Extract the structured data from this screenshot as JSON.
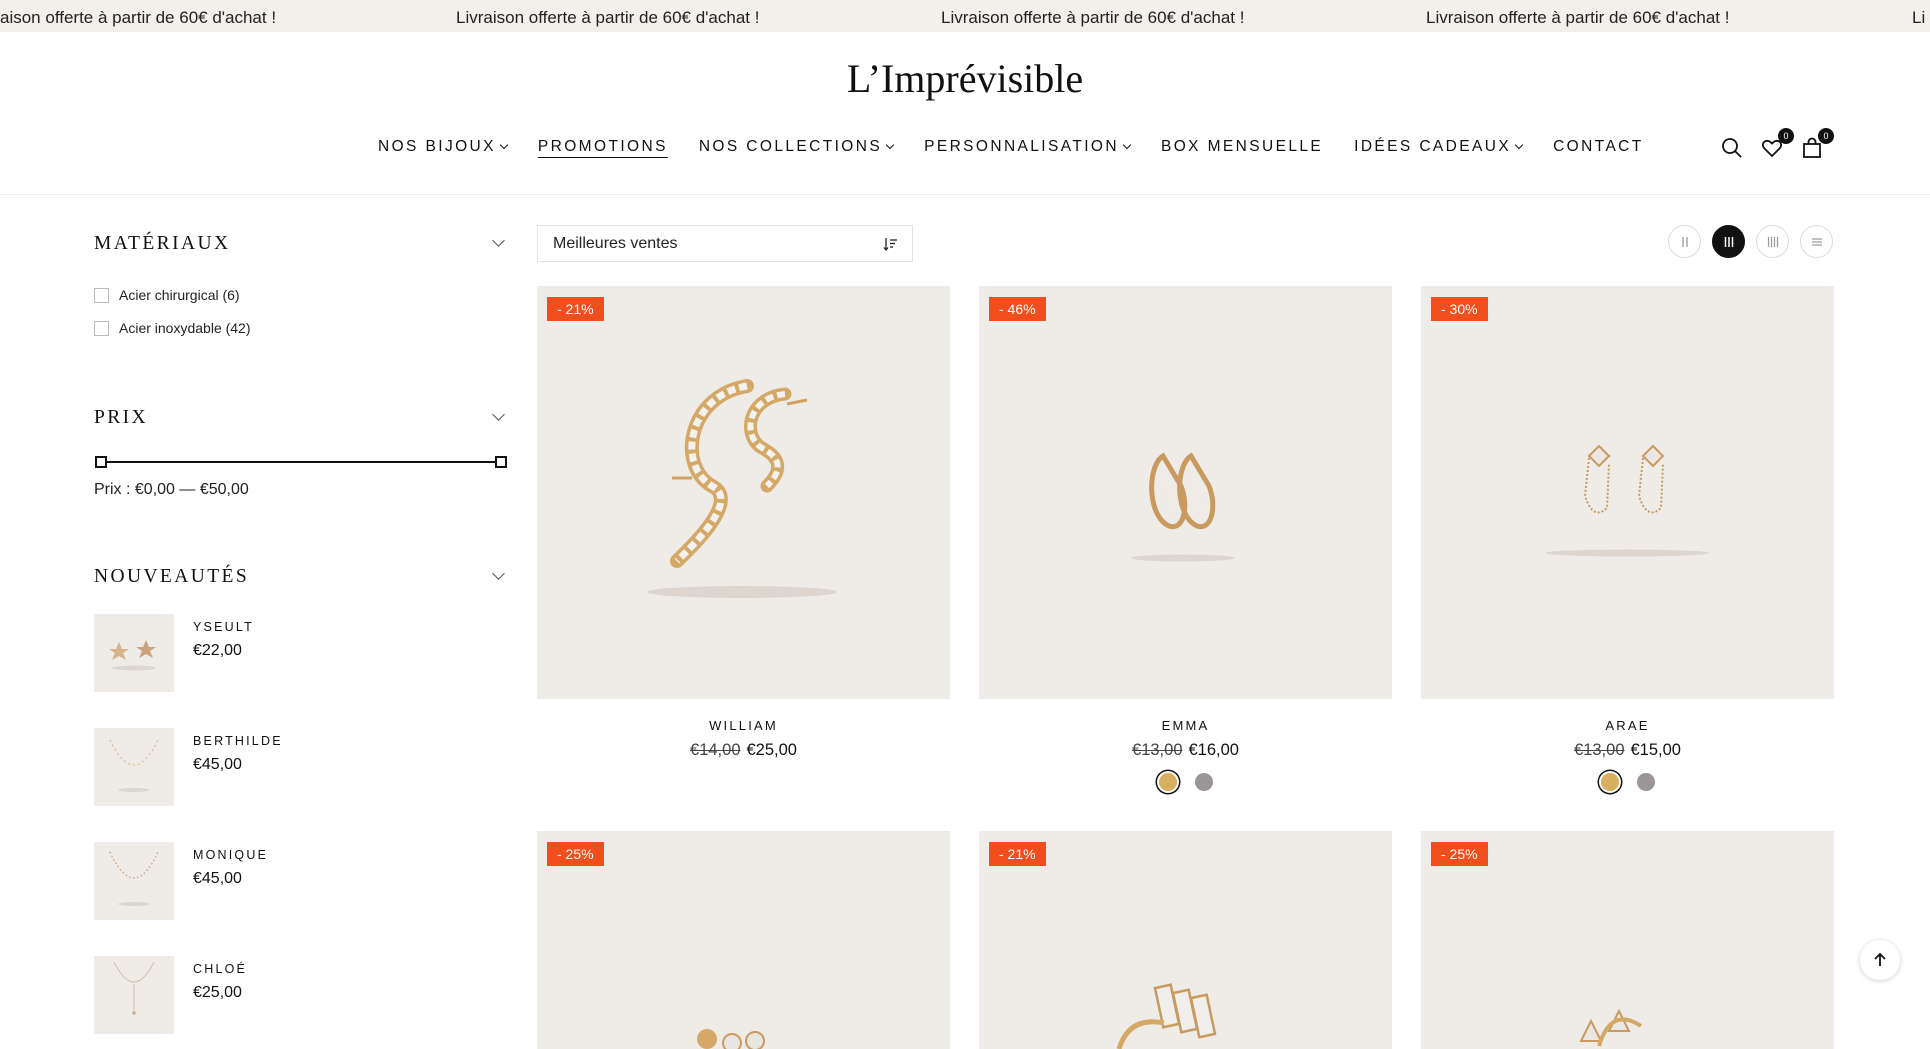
{
  "announcement": {
    "text1": "aison offerte à partir de 60€ d'achat !",
    "text2": "Livraison offerte à partir de 60€ d'achat !",
    "text3": "Livraison offerte à partir de 60€ d'achat !",
    "text4": "Livraison offerte à partir de 60€ d'achat !",
    "text5": "Li"
  },
  "header": {
    "logo": "L’Imprévisible",
    "nav": [
      {
        "label": "NOS BIJOUX"
      },
      {
        "label": "PROMOTIONS"
      },
      {
        "label": "NOS COLLECTIONS"
      },
      {
        "label": "PERSONNALISATION"
      },
      {
        "label": "BOX MENSUELLE"
      },
      {
        "label": "IDÉES CADEAUX"
      },
      {
        "label": "CONTACT"
      }
    ],
    "wishlist_count": "0",
    "cart_count": "0",
    "icons": [
      "search-icon",
      "heart-icon",
      "bag-icon"
    ]
  },
  "sidebar": {
    "materials_title": "MATÉRIAUX",
    "materials": [
      {
        "label": "Acier chirurgical (6)"
      },
      {
        "label": "Acier inoxydable (42)"
      }
    ],
    "price_title": "PRIX",
    "price_label": "Prix :  €0,00 — €50,00",
    "price_range": {
      "min_value": 0,
      "max_value": 50
    },
    "new_title": "NOUVEAUTÉS",
    "new_items": [
      {
        "name": "YSEULT",
        "price": "€22,00"
      },
      {
        "name": "BERTHILDE",
        "price": "€45,00"
      },
      {
        "name": "MONIQUE",
        "price": "€45,00"
      },
      {
        "name": "CHLOÉ",
        "price": "€25,00"
      }
    ]
  },
  "toolbar": {
    "sort_value": "Meilleures ventes",
    "layout_options": [
      "two-columns-icon",
      "three-columns-icon",
      "four-columns-icon",
      "list-view-icon"
    ],
    "active_layout": "three-columns-icon"
  },
  "products": [
    {
      "badge": "- 21%",
      "name": "WILLIAM",
      "old_price": "€14,00",
      "price": "€25,00",
      "swatches": []
    },
    {
      "badge": "- 46%",
      "name": "EMMA",
      "old_price": "€13,00",
      "price": "€16,00",
      "swatches": [
        "#d8ae5f",
        "#9a9695"
      ]
    },
    {
      "badge": "- 30%",
      "name": "ARAE",
      "old_price": "€13,00",
      "price": "€15,00",
      "swatches": [
        "#d8ae5f",
        "#9a9695"
      ]
    },
    {
      "badge": "- 25%"
    },
    {
      "badge": "- 21%"
    },
    {
      "badge": "- 25%"
    }
  ],
  "colors": {
    "badge": "#f04e1c",
    "image_background": "#efebe7",
    "announcement_background": "#f3efeb",
    "gold": "#d8ae5f",
    "silver": "#9a9695"
  }
}
